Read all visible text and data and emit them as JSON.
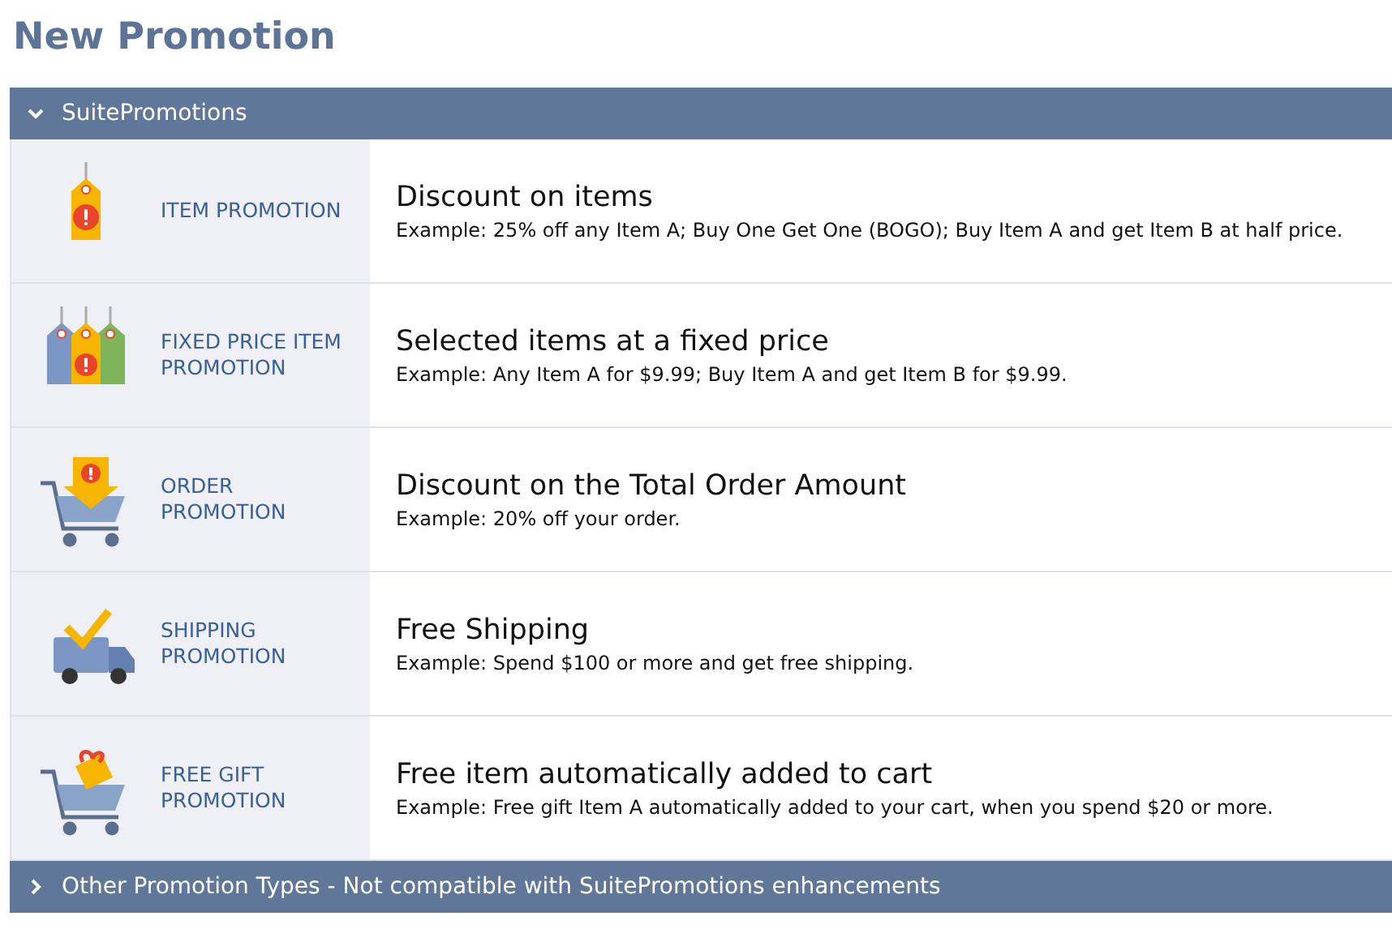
{
  "title": "New Promotion",
  "sections": [
    {
      "label": "SuitePromotions",
      "expanded": true,
      "rows": [
        {
          "kind": "tag",
          "name": "ITEM PROMOTION",
          "heading": "Discount on items",
          "example": "Example: 25% off any Item A; Buy One Get One (BOGO); Buy Item A and get Item B at half price."
        },
        {
          "kind": "tags",
          "name": "FIXED PRICE ITEM PROMOTION",
          "heading": "Selected items at a fixed price",
          "example": "Example: Any Item A for $9.99; Buy Item A and get Item B for $9.99."
        },
        {
          "kind": "cart-order",
          "name": "ORDER PROMOTION",
          "heading": "Discount on the Total Order Amount",
          "example": "Example: 20% off your order."
        },
        {
          "kind": "truck",
          "name": "SHIPPING PROMOTION",
          "heading": "Free Shipping",
          "example": "Example: Spend $100 or more and get free shipping."
        },
        {
          "kind": "cart-gift",
          "name": "FREE GIFT PROMOTION",
          "heading": "Free item automatically added to cart",
          "example": "Example: Free gift Item A automatically added to your cart, when you spend $20 or more."
        }
      ]
    },
    {
      "label": "Other Promotion Types - Not compatible with SuitePromotions enhancements",
      "expanded": false
    }
  ]
}
